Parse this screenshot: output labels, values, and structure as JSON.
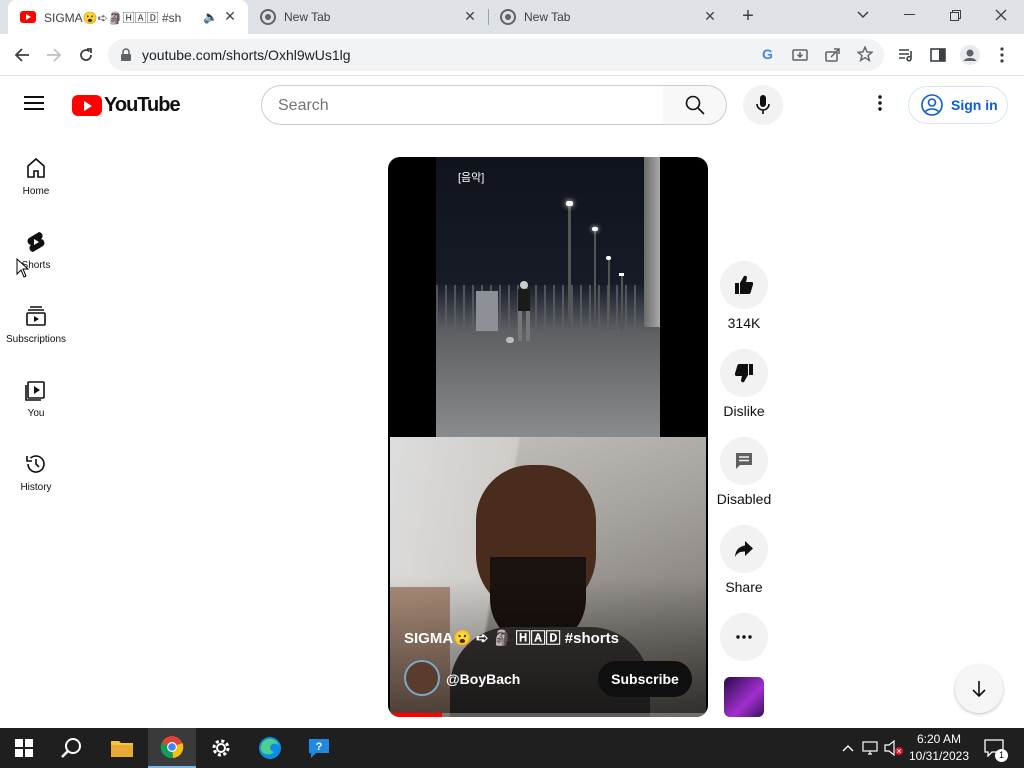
{
  "browser": {
    "tabs": [
      {
        "title": "SIGMA😮➪🗿🄷🄰🄳 #sh",
        "active": true
      },
      {
        "title": "New Tab",
        "active": false
      },
      {
        "title": "New Tab",
        "active": false
      }
    ],
    "url": "youtube.com/shorts/Oxhl9wUs1lg"
  },
  "youtube": {
    "logo_text": "YouTube",
    "search_placeholder": "Search",
    "sign_in_label": "Sign in",
    "guide": [
      {
        "label": "Home",
        "icon": "home-icon"
      },
      {
        "label": "Shorts",
        "icon": "shorts-icon"
      },
      {
        "label": "Subscriptions",
        "icon": "subscriptions-icon"
      },
      {
        "label": "You",
        "icon": "you-icon"
      },
      {
        "label": "History",
        "icon": "history-icon"
      }
    ],
    "short": {
      "music_label": "[음악]",
      "title": "SIGMA😮 ➪ 🗿 🄷🄰🄳 #shorts",
      "channel": "@BoyBach",
      "subscribe_label": "Subscribe",
      "progress": 0.17
    },
    "actions": {
      "like_count": "314K",
      "dislike_label": "Dislike",
      "comments_label": "Disabled",
      "share_label": "Share"
    }
  },
  "taskbar": {
    "time": "6:20 AM",
    "date": "10/31/2023",
    "notification_count": "1"
  },
  "colors": {
    "youtube_red": "#ff0000",
    "link_blue": "#065fd4",
    "taskbar": "#1f1f1f"
  }
}
